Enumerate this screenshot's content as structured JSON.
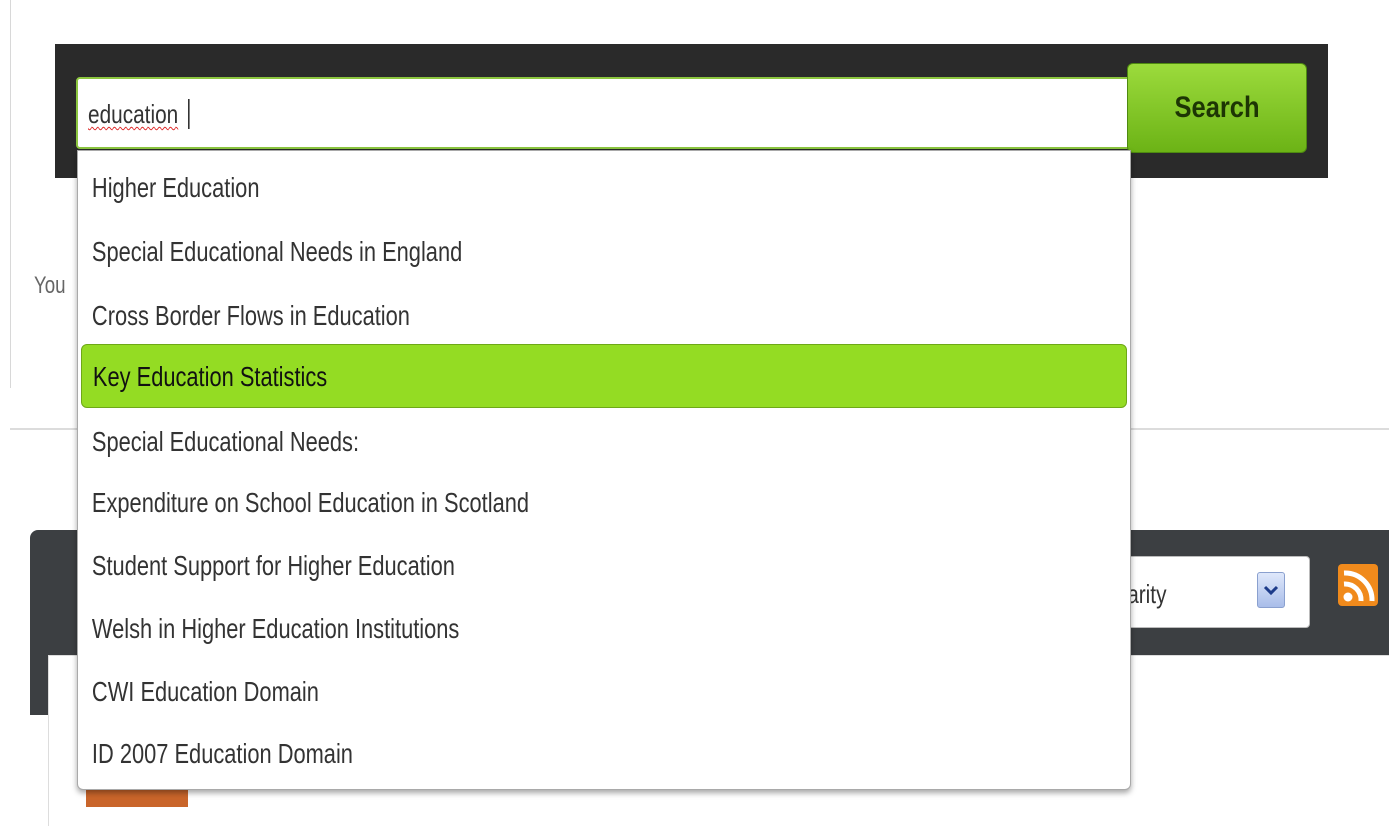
{
  "search": {
    "query": "education",
    "button_label": "Search"
  },
  "background": {
    "partial_text": "You",
    "sort_select_value": "ularity"
  },
  "autocomplete": {
    "items": [
      "Higher Education",
      "Special Educational Needs in England",
      "Cross Border Flows in Education",
      "Key Education Statistics",
      "Special Educational Needs:",
      "Expenditure on School Education in Scotland",
      "Student Support for Higher Education",
      "Welsh in Higher Education Institutions",
      "CWI Education Domain",
      "ID 2007 Education Domain"
    ],
    "highlighted_index": 3
  },
  "icons": [
    "chevron-down-icon",
    "rss-icon"
  ],
  "colors": {
    "accent_green": "#94dc23",
    "search_button": "#7cc526",
    "header_bar": "#2a2a2a",
    "toolbar": "#3c3f42",
    "rss_orange": "#f08a1c",
    "tag_orange": "#c9652a"
  }
}
